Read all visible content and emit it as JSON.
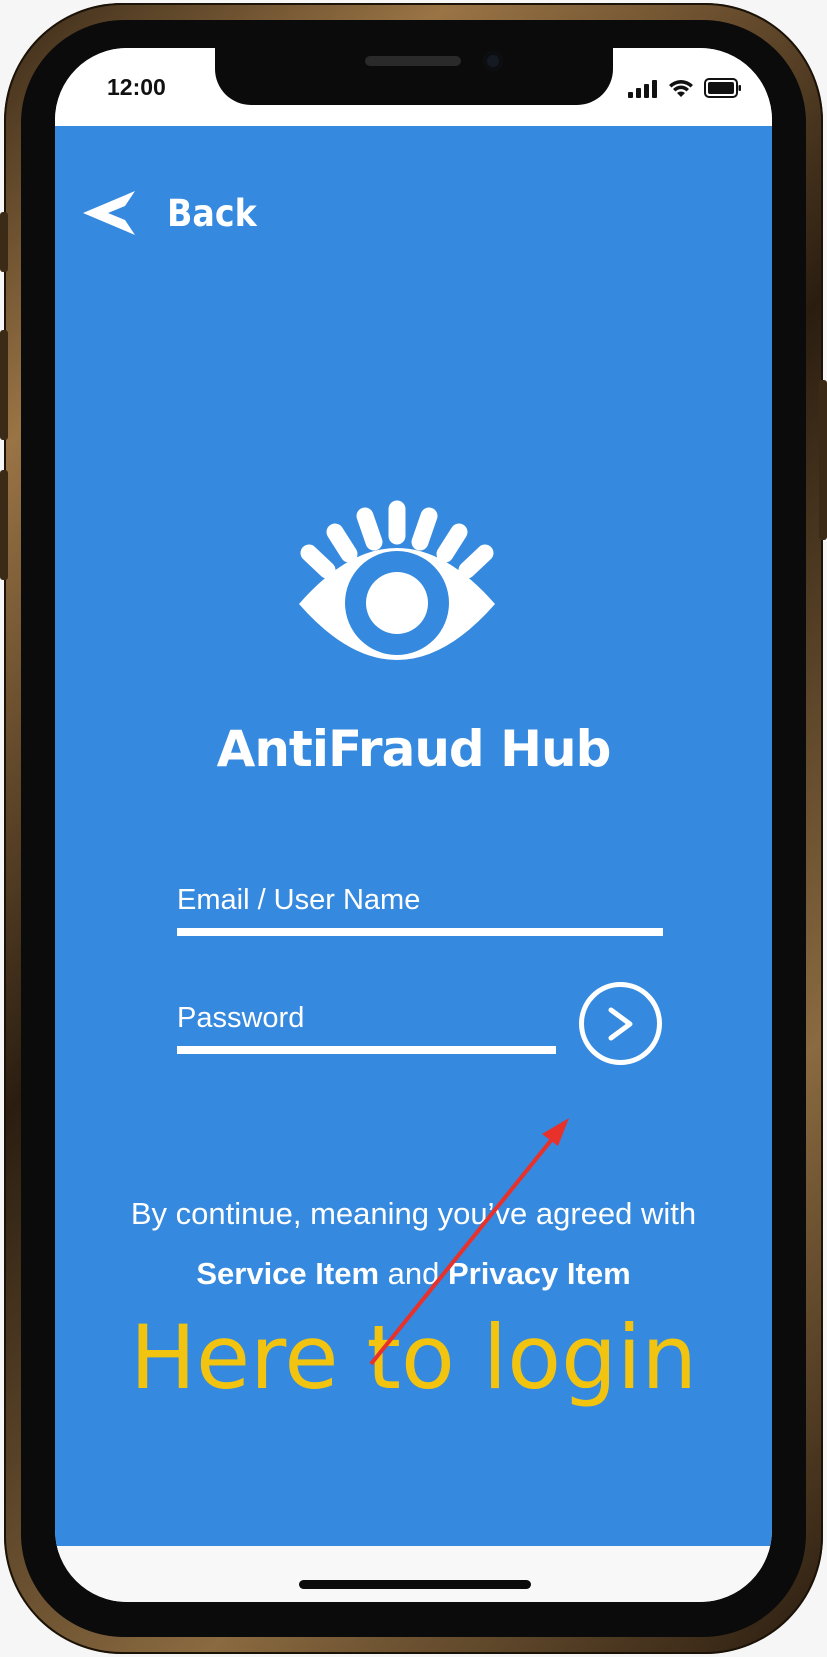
{
  "status_bar": {
    "time": "12:00"
  },
  "nav": {
    "back_label": "Back"
  },
  "app": {
    "title": "AntiFraud Hub"
  },
  "form": {
    "email_placeholder": "Email / User Name",
    "password_placeholder": "Password"
  },
  "agreement": {
    "line1": "By continue, meaning you’ve agreed with",
    "service_link": "Service Item",
    "connector": " and ",
    "privacy_link": "Privacy Item"
  },
  "annotation": {
    "text": "Here to login"
  },
  "colors": {
    "app_background": "#3589de",
    "annotation_text": "#f2c40f",
    "annotation_arrow": "#e8312a"
  }
}
